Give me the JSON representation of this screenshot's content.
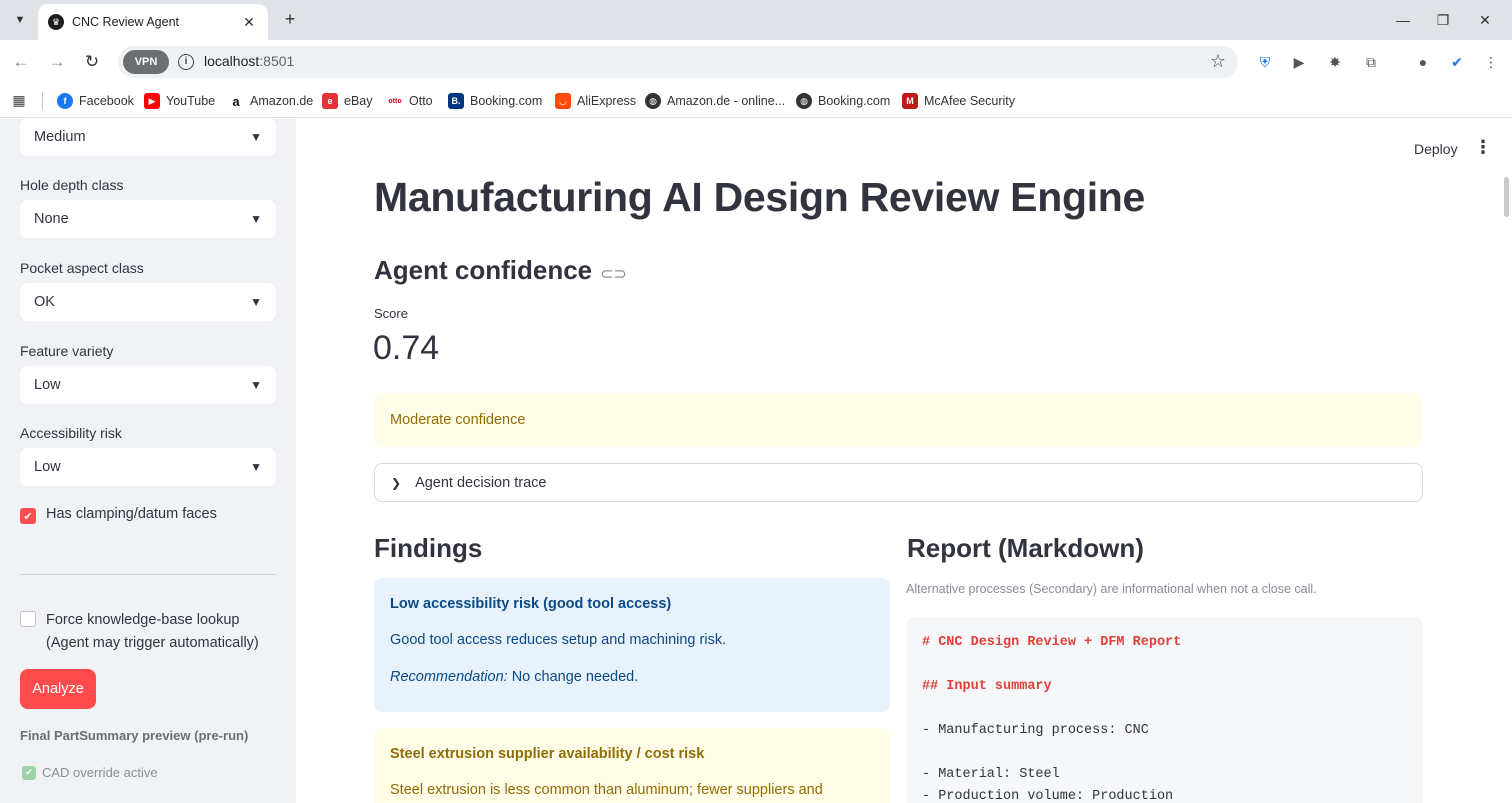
{
  "browser": {
    "tab_title": "CNC Review Agent",
    "url_host": "localhost",
    "url_port": ":8501",
    "vpn_label": "VPN",
    "bookmarks": [
      "Facebook",
      "YouTube",
      "Amazon.de",
      "eBay",
      "Otto",
      "Booking.com",
      "AliExpress",
      "Amazon.de - online...",
      "Booking.com",
      "McAfee Security"
    ]
  },
  "sidebar": {
    "top_select": "Medium",
    "hole_depth": {
      "label": "Hole depth class",
      "value": "None"
    },
    "pocket_aspect": {
      "label": "Pocket aspect class",
      "value": "OK"
    },
    "feature_variety": {
      "label": "Feature variety",
      "value": "Low"
    },
    "accessibility": {
      "label": "Accessibility risk",
      "value": "Low"
    },
    "clamping": {
      "label": "Has clamping/datum faces",
      "checked": true
    },
    "force_kb": {
      "label_line1": "Force knowledge-base lookup",
      "label_line2": "(Agent may trigger automatically)",
      "checked": false
    },
    "analyze_label": "Analyze",
    "preview_caption": "Final PartSummary preview (pre-run)",
    "cad_override": "CAD override active"
  },
  "main": {
    "deploy_label": "Deploy",
    "title": "Manufacturing AI Design Review Engine",
    "confidence_heading": "Agent confidence",
    "score_label": "Score",
    "score_value": "0.74",
    "confidence_note": "Moderate confidence",
    "trace_label": "Agent decision trace",
    "findings_heading": "Findings",
    "findings": [
      {
        "title": "Low accessibility risk (good tool access)",
        "body": "Good tool access reduces setup and machining risk.",
        "rec_label": "Recommendation:",
        "rec_text": " No change needed."
      },
      {
        "title": "Steel extrusion supplier availability / cost risk",
        "body": "Steel extrusion is less common than aluminum; fewer suppliers and"
      }
    ],
    "report_heading": "Report (Markdown)",
    "report_caption": "Alternative processes (Secondary) are informational when not a close call.",
    "report_lines": [
      "# CNC Design Review + DFM Report",
      "## Input summary",
      "- Manufacturing process: CNC",
      "- Material: Steel",
      "- Production volume: Production"
    ]
  },
  "colors": {
    "accent": "#ff4b4b",
    "info_bg": "#e8f2fc",
    "warn_bg": "#fffde7",
    "sidebar_bg": "#f0f2f6"
  }
}
